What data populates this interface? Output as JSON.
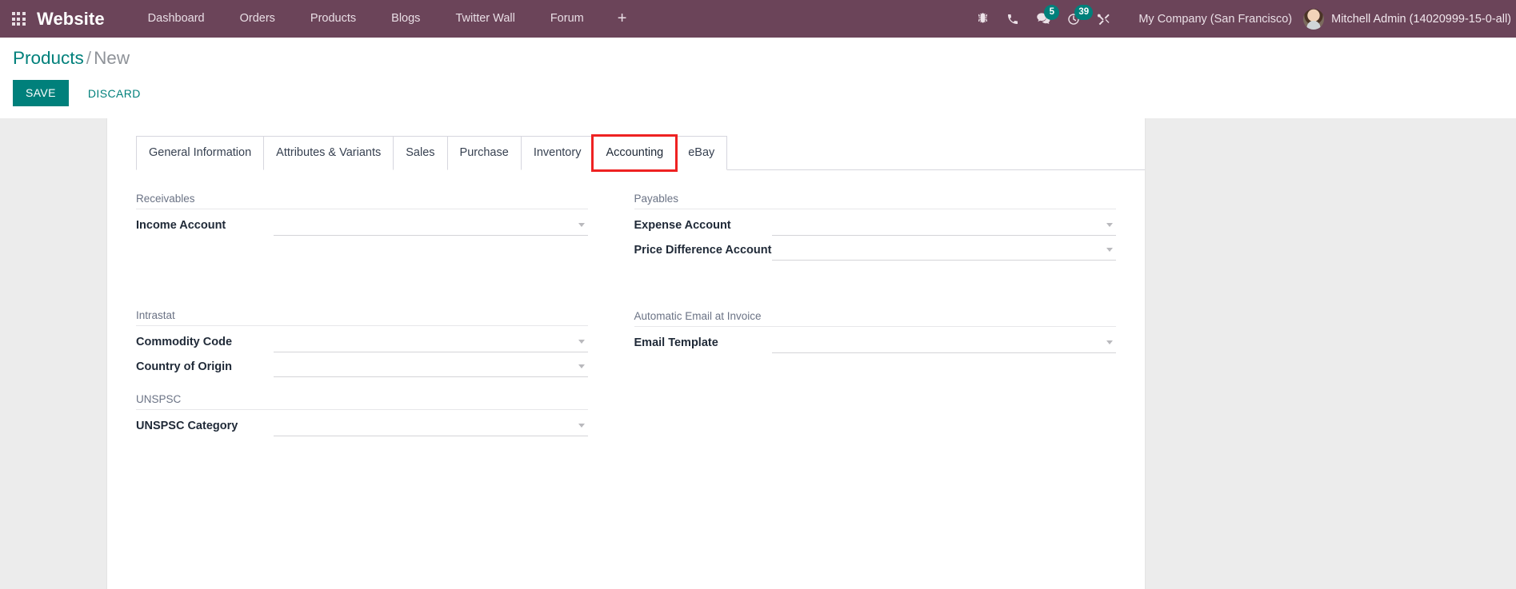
{
  "navbar": {
    "apps_icon": "apps-grid-icon",
    "brand": "Website",
    "menu_items": [
      {
        "label": "Dashboard"
      },
      {
        "label": "Orders"
      },
      {
        "label": "Products"
      },
      {
        "label": "Blogs"
      },
      {
        "label": "Twitter Wall"
      },
      {
        "label": "Forum"
      }
    ],
    "add_label": "+",
    "system_icons": [
      {
        "name": "bug-icon",
        "badge": ""
      },
      {
        "name": "phone-icon",
        "badge": ""
      },
      {
        "name": "messages-icon",
        "badge": "5"
      },
      {
        "name": "activities-clock-icon",
        "badge": "39"
      },
      {
        "name": "tools-icon",
        "badge": ""
      }
    ],
    "company": "My Company (San Francisco)",
    "user": "Mitchell Admin (14020999-15-0-all)",
    "colors": {
      "background": "#6B4459",
      "badge": "#00807B",
      "text": "#f1e7ed"
    }
  },
  "control_panel": {
    "breadcrumb_root": "Products",
    "breadcrumb_separator": "/",
    "breadcrumb_current": "New",
    "save_label": "SAVE",
    "discard_label": "DISCARD",
    "accent_color": "#00807B"
  },
  "notebook": {
    "tabs": [
      {
        "label": "General Information",
        "active": false,
        "highlighted": false
      },
      {
        "label": "Attributes & Variants",
        "active": false,
        "highlighted": false
      },
      {
        "label": "Sales",
        "active": false,
        "highlighted": false
      },
      {
        "label": "Purchase",
        "active": false,
        "highlighted": false
      },
      {
        "label": "Inventory",
        "active": false,
        "highlighted": false
      },
      {
        "label": "Accounting",
        "active": true,
        "highlighted": true
      },
      {
        "label": "eBay",
        "active": false,
        "highlighted": false
      }
    ],
    "highlight_color": "#ee2222"
  },
  "form": {
    "left": {
      "receivables": {
        "title": "Receivables",
        "fields": [
          {
            "label": "Income Account",
            "value": "",
            "placeholder": "",
            "dropdown": true
          }
        ]
      },
      "intrastat": {
        "title": "Intrastat",
        "fields": [
          {
            "label": "Commodity Code",
            "value": "",
            "placeholder": "",
            "dropdown": true
          },
          {
            "label": "Country of Origin",
            "value": "",
            "placeholder": "",
            "dropdown": true
          }
        ]
      },
      "unspsc": {
        "title": "UNSPSC",
        "fields": [
          {
            "label": "UNSPSC Category",
            "value": "",
            "placeholder": "",
            "dropdown": true
          }
        ]
      }
    },
    "right": {
      "payables": {
        "title": "Payables",
        "fields": [
          {
            "label": "Expense Account",
            "value": "",
            "placeholder": "",
            "dropdown": true
          },
          {
            "label": "Price Difference Account",
            "value": "",
            "placeholder": "",
            "dropdown": true
          }
        ]
      },
      "auto_email": {
        "title": "Automatic Email at Invoice",
        "fields": [
          {
            "label": "Email Template",
            "value": "",
            "placeholder": "",
            "dropdown": true
          }
        ]
      }
    }
  }
}
